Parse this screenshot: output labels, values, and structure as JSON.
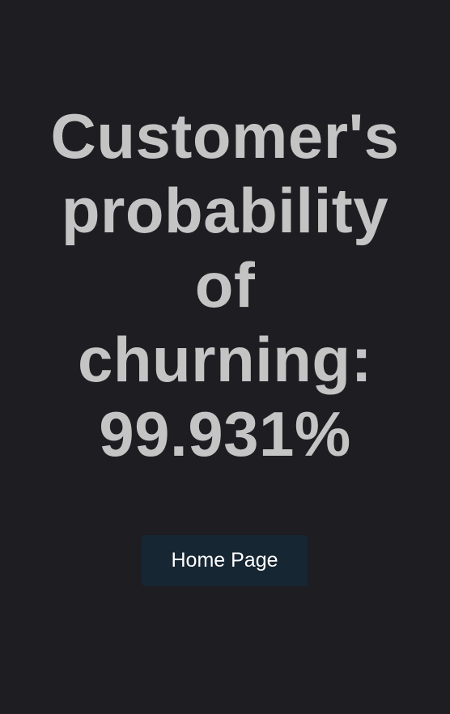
{
  "result": {
    "line1": "Customer's",
    "line2": "probability",
    "line3": "of",
    "line4": "churning:",
    "value": "99.931%"
  },
  "home_button": {
    "label": "Home Page"
  },
  "colors": {
    "background": "#1e1d22",
    "heading_text": "#c4c4c4",
    "button_bg": "#172633",
    "button_text": "#ffffff"
  }
}
